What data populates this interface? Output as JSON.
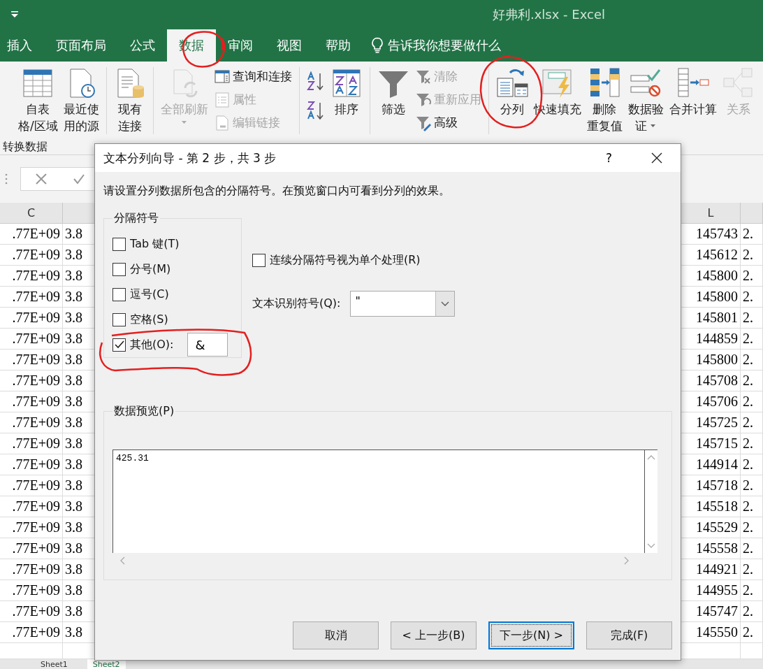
{
  "window": {
    "title": "好弗利.xlsx  -  Excel"
  },
  "tabs": [
    {
      "label": "插入",
      "selected": false
    },
    {
      "label": "页面布局",
      "selected": false
    },
    {
      "label": "公式",
      "selected": false
    },
    {
      "label": "数据",
      "selected": true
    },
    {
      "label": "审阅",
      "selected": false
    },
    {
      "label": "视图",
      "selected": false
    },
    {
      "label": "帮助",
      "selected": false
    }
  ],
  "tell_me": "告诉我你想要做什么",
  "ribbon": {
    "columns": [
      {
        "kind": "large",
        "lines": [
          "自表",
          "格/区域"
        ],
        "disabled": false,
        "dropdown": false
      },
      {
        "kind": "large",
        "lines": [
          "最近使",
          "用的源"
        ],
        "disabled": false,
        "dropdown": false
      },
      {
        "kind": "separator"
      },
      {
        "kind": "large",
        "lines": [
          "现有",
          "连接"
        ],
        "disabled": false,
        "dropdown": false
      },
      {
        "kind": "separator"
      },
      {
        "kind": "large",
        "lines": [
          "全部刷新"
        ],
        "disabled": true,
        "dropdown": true
      },
      {
        "kind": "stack",
        "items": [
          {
            "label": "查询和连接",
            "disabled": false
          },
          {
            "label": "属性",
            "disabled": true
          },
          {
            "label": "编辑链接",
            "disabled": true
          }
        ]
      },
      {
        "kind": "separator"
      },
      {
        "kind": "sort_pair"
      },
      {
        "kind": "large",
        "lines": [
          "排序"
        ],
        "disabled": false,
        "dropdown": false
      },
      {
        "kind": "separator"
      },
      {
        "kind": "large",
        "lines": [
          "筛选"
        ],
        "disabled": false,
        "dropdown": false
      },
      {
        "kind": "stack",
        "items": [
          {
            "label": "清除",
            "disabled": true
          },
          {
            "label": "重新应用",
            "disabled": true
          },
          {
            "label": "高级",
            "disabled": false
          }
        ]
      },
      {
        "kind": "separator"
      },
      {
        "kind": "large",
        "lines": [
          "分列"
        ],
        "disabled": false,
        "dropdown": false
      },
      {
        "kind": "large",
        "lines": [
          "快速填充"
        ],
        "disabled": false,
        "dropdown": false
      },
      {
        "kind": "large",
        "lines": [
          "删除",
          "重复值"
        ],
        "disabled": false,
        "dropdown": false
      },
      {
        "kind": "large",
        "lines": [
          "数据验",
          "证"
        ],
        "disabled": false,
        "dropdown": true
      },
      {
        "kind": "large",
        "lines": [
          "合并计算"
        ],
        "disabled": false,
        "dropdown": false
      },
      {
        "kind": "large",
        "lines": [
          "关系"
        ],
        "disabled": true,
        "dropdown": false
      }
    ],
    "group_label": "转换数据"
  },
  "grid": {
    "headers": [
      "C",
      "L"
    ],
    "rows": [
      [
        ".77E+09",
        "3.8",
        "145743",
        "2."
      ],
      [
        ".77E+09",
        "3.8",
        "145612",
        "2."
      ],
      [
        ".77E+09",
        "3.8",
        "145800",
        "2."
      ],
      [
        ".77E+09",
        "3.8",
        "145800",
        "2."
      ],
      [
        ".77E+09",
        "3.8",
        "145801",
        "2."
      ],
      [
        ".77E+09",
        "3.8",
        "144859",
        "2."
      ],
      [
        ".77E+09",
        "3.8",
        "145800",
        "2."
      ],
      [
        ".77E+09",
        "3.8",
        "145708",
        "2."
      ],
      [
        ".77E+09",
        "3.8",
        "145706",
        "2."
      ],
      [
        ".77E+09",
        "3.8",
        "145725",
        "2."
      ],
      [
        ".77E+09",
        "3.8",
        "145715",
        "2."
      ],
      [
        ".77E+09",
        "3.8",
        "144914",
        "2."
      ],
      [
        ".77E+09",
        "3.8",
        "145718",
        "2."
      ],
      [
        ".77E+09",
        "3.8",
        "145518",
        "2."
      ],
      [
        ".77E+09",
        "3.8",
        "145529",
        "2."
      ],
      [
        ".77E+09",
        "3.8",
        "145558",
        "2."
      ],
      [
        ".77E+09",
        "3.8",
        "144921",
        "2."
      ],
      [
        ".77E+09",
        "3.8",
        "144955",
        "2."
      ],
      [
        ".77E+09",
        "3.8",
        "145747",
        "2."
      ],
      [
        ".77E+09",
        "3.8",
        "145550",
        "2."
      ]
    ]
  },
  "sheet_tabs": [
    {
      "label": "Sheet1",
      "selected": false
    },
    {
      "label": "Sheet2",
      "selected": true
    }
  ],
  "dialog": {
    "title": "文本分列向导 - 第 2 步，共 3 步",
    "help": "?",
    "instruction": "请设置分列数据所包含的分隔符号。在预览窗口内可看到分列的效果。",
    "delimiters": {
      "legend": "分隔符号",
      "options": [
        {
          "label": "Tab 键(T)",
          "checked": false
        },
        {
          "label": "分号(M)",
          "checked": false
        },
        {
          "label": "逗号(C)",
          "checked": false
        },
        {
          "label": "空格(S)",
          "checked": false
        },
        {
          "label": "其他(O):",
          "checked": true,
          "value": "&"
        }
      ]
    },
    "consecutive": {
      "label": "连续分隔符号视为单个处理(R)",
      "checked": false
    },
    "qualifier": {
      "label": "文本识别符号(Q):",
      "value": "\""
    },
    "preview": {
      "legend": "数据预览(P)",
      "lines": [
        "425.31"
      ]
    },
    "buttons": [
      {
        "label": "取消",
        "default": false
      },
      {
        "label": "< 上一步(B)",
        "default": false
      },
      {
        "label": "下一步(N) >",
        "default": true
      },
      {
        "label": "完成(F)",
        "default": false
      }
    ]
  }
}
